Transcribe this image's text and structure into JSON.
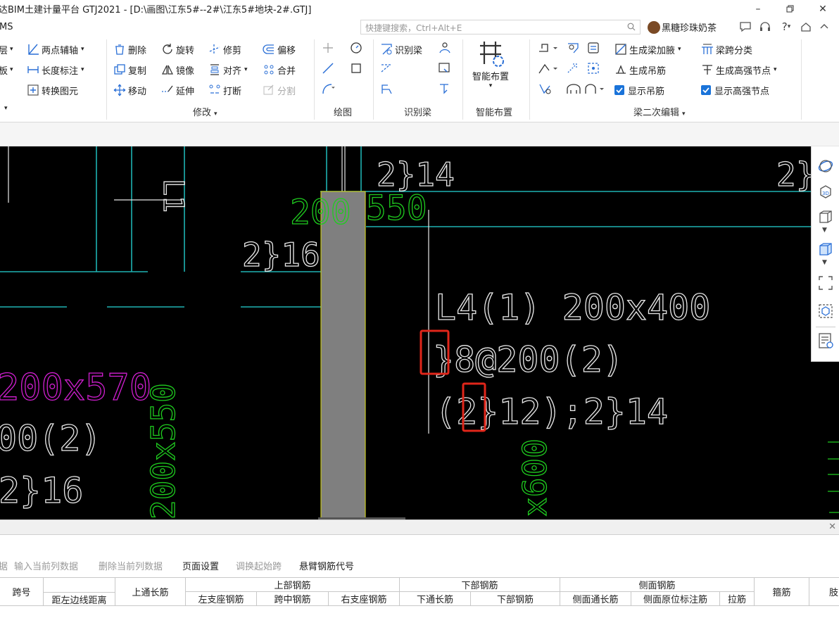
{
  "app": {
    "title": "达BIM土建计量平台 GTJ2021 - [D:\\画图\\江东5#--2#\\江东5#地块-2#.GTJ]",
    "menu_partial": "MS",
    "search_placeholder": "快捷键搜索，Ctrl+Alt+E",
    "user_name": "黑糖珍珠奶茶",
    "help_label": "?"
  },
  "ribbon": {
    "group0": {
      "items": [
        "层",
        "板",
        "两点辅轴",
        "长度标注",
        "转换图元"
      ]
    },
    "modify": {
      "label": "修改",
      "items": [
        "删除",
        "旋转",
        "修剪",
        "偏移",
        "复制",
        "镜像",
        "对齐",
        "合并",
        "移动",
        "延伸",
        "打断",
        "分割"
      ]
    },
    "draw": {
      "label": "绘图"
    },
    "recognize": {
      "label": "识别梁",
      "items": [
        "识别梁"
      ]
    },
    "smart": {
      "label": "智能布置",
      "button": "智能布置"
    },
    "beam2": {
      "label": "梁二次编辑",
      "items": [
        "生成梁加腋",
        "梁跨分类",
        "生成吊筋",
        "生成高强节点",
        "显示吊筋",
        "显示高强节点"
      ]
    }
  },
  "canvas": {
    "texts": {
      "t1": "2}14",
      "t2": "2}",
      "t3": "200",
      "t4": "550",
      "t5": "2}16",
      "t6": "L4(1) 200x400",
      "t7": "}8@200(2)",
      "t8": "(2}12);2}14",
      "t9": "200x570",
      "t10": "00(2)",
      "t11": "2}16",
      "t12": "200x550",
      "t13": "x600",
      "t14": "L1"
    },
    "colors": {
      "cyan": "#1fb3b3",
      "green": "#1fcc1f",
      "magenta": "#d21fd2",
      "white": "#e8e8e8",
      "column": "#7f7f7f",
      "highlight": "#e0261a"
    }
  },
  "bottom_panel": {
    "toolbar": [
      "据",
      "输入当前列数据",
      "删除当前列数据",
      "页面设置",
      "调换起始跨",
      "悬臂钢筋代号"
    ],
    "headers": {
      "span_no": "跨号",
      "dist_left": "距左边线距离",
      "top_through": "上通长筋",
      "top_rebar": "上部钢筋",
      "left_support": "左支座钢筋",
      "mid_span": "跨中钢筋",
      "right_support": "右支座钢筋",
      "bottom_rebar": "下部钢筋",
      "bottom_through": "下通长筋",
      "bottom_rebar2": "下部钢筋",
      "side_rebar": "侧面钢筋",
      "side_through": "侧面通长筋",
      "side_original": "侧面原位标注筋",
      "tie": "拉筋",
      "stirrup": "箍筋",
      "extra": "肢"
    }
  }
}
